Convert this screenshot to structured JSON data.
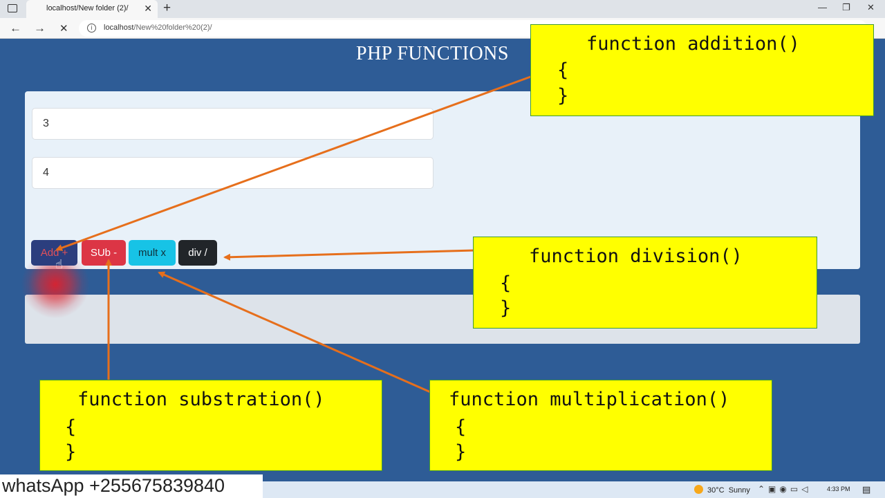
{
  "browser": {
    "tab_title": "localhost/New folder (2)/",
    "tab_close": "✕",
    "new_tab": "+",
    "url_host": "localhost",
    "url_path": "/New%20folder%20(2)/",
    "back": "←",
    "forward": "→",
    "stop": "✕",
    "minimize": "—",
    "restore": "❐",
    "close": "✕"
  },
  "page": {
    "title": "PHP FUNCTIONS",
    "input1_value": "3",
    "input2_value": "4",
    "buttons": {
      "add": "Add +",
      "sub": "SUb -",
      "mult": "mult x",
      "div": "div /"
    }
  },
  "annotations": {
    "addition": {
      "head": "function addition()",
      "open": "{",
      "close": "}"
    },
    "division": {
      "head": "function division()",
      "open": "{",
      "close": "}"
    },
    "substraction": {
      "head": "function substration()",
      "open": "{",
      "close": "}"
    },
    "multiplication": {
      "head": "function multiplication()",
      "open": "{",
      "close": "}"
    }
  },
  "taskbar": {
    "temperature": "30°C",
    "weather": "Sunny",
    "time": "4:33 PM"
  },
  "watermark": "whatsApp +255675839840",
  "colors": {
    "page_bg": "#2e5c96",
    "note_bg": "#ffff00",
    "arrow": "#e66f1c",
    "btn_add": "#2b3e7e",
    "btn_sub": "#dc3545",
    "btn_mult": "#17c3e6",
    "btn_div": "#212529"
  }
}
